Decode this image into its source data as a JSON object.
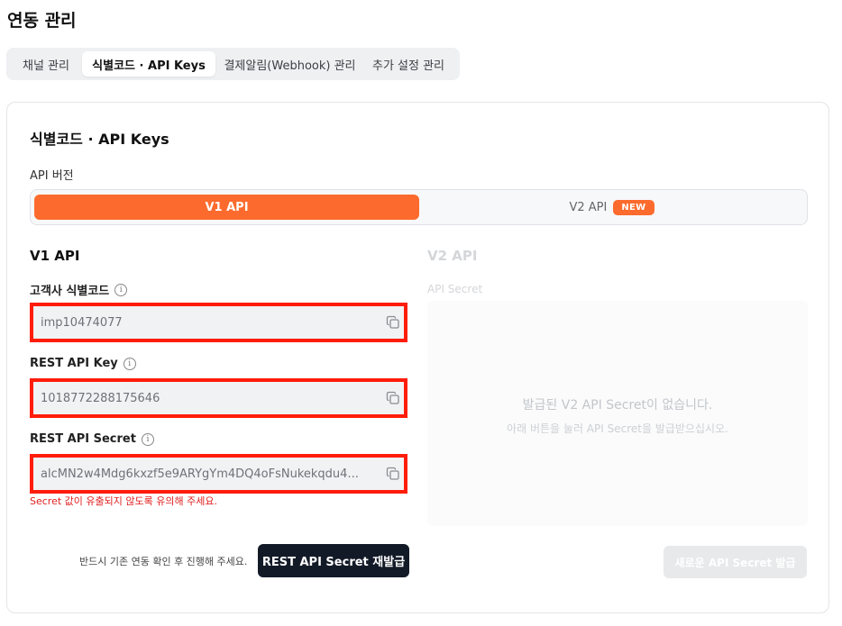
{
  "page": {
    "title": "연동 관리"
  },
  "tabs": [
    {
      "label": "채널 관리"
    },
    {
      "label": "식별코드 · API Keys"
    },
    {
      "label": "결제알림(Webhook) 관리"
    },
    {
      "label": "추가 설정 관리"
    }
  ],
  "card": {
    "title": "식별코드 · API Keys",
    "version_label": "API 버전",
    "version_v1": "V1 API",
    "version_v2": "V2 API",
    "new_badge": "NEW"
  },
  "v1": {
    "title": "V1 API",
    "fields": [
      {
        "label": "고객사 식별코드",
        "value": "imp10474077"
      },
      {
        "label": "REST API Key",
        "value": "1018772288175646"
      },
      {
        "label": "REST API Secret",
        "value": "alcMN2w4Mdg6kxzf5e9ARYgYm4DQ4oFsNukekqdu4..."
      }
    ],
    "warning": "Secret 값이 유출되지 않도록 유의해 주세요.",
    "notice": "반드시 기존 연동 확인 후 진행해 주세요.",
    "reissue_button": "REST API Secret 재발급"
  },
  "v2": {
    "title": "V2 API",
    "subtitle": "API Secret",
    "empty_title": "발급된 V2 API Secret이 없습니다.",
    "empty_desc": "아래 버튼을 눌러 API Secret을 발급받으십시오.",
    "issue_button": "새로운 API Secret 발급"
  },
  "colors": {
    "accent": "#fc6b2d",
    "highlight_border": "#ff1d0a",
    "primary_button": "#131a27",
    "warning": "#e02020"
  }
}
